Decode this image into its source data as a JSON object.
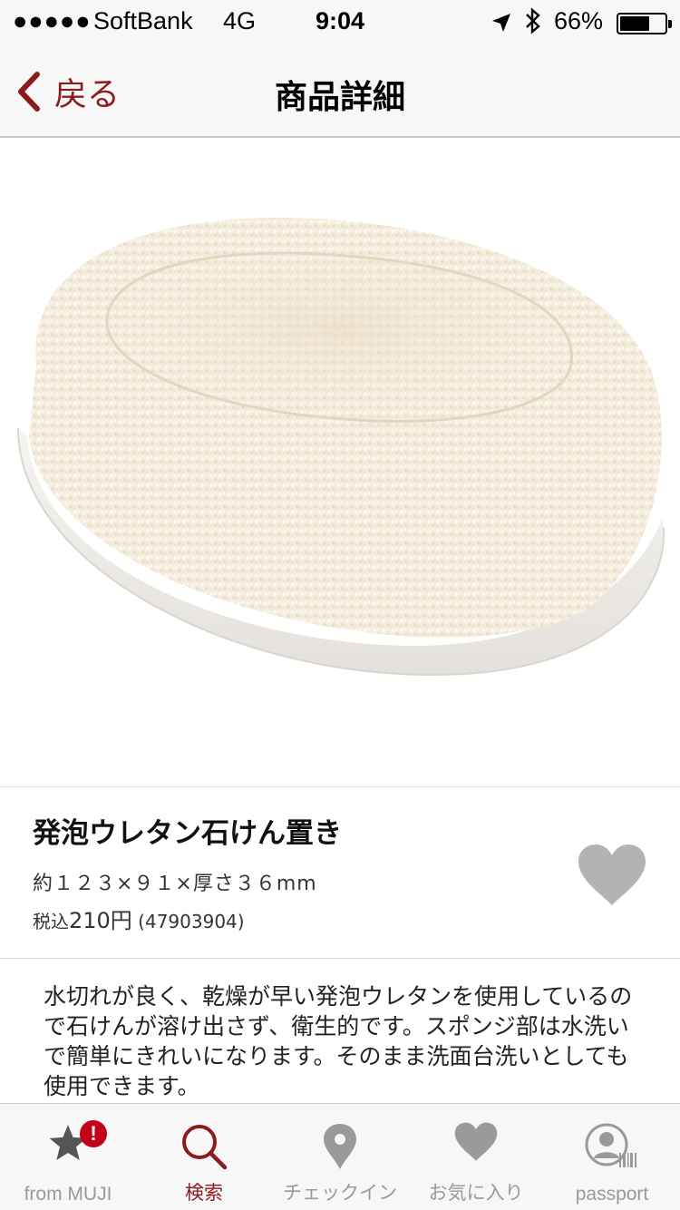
{
  "status_bar": {
    "signal": "●●●●●",
    "carrier": "SoftBank",
    "network": "4G",
    "time": "9:04",
    "battery": "66%",
    "battery_level": 0.66,
    "icons": [
      "location-arrow-icon",
      "bluetooth-icon",
      "battery-icon"
    ]
  },
  "nav": {
    "back_label": "戻る",
    "title": "商品詳細"
  },
  "product": {
    "name": "発泡ウレタン石けん置き",
    "size": "約１２３×９１×厚さ３６mm",
    "price_prefix": "税込",
    "price": "210円",
    "code": "(47903904)",
    "description": "水切れが良く、乾燥が早い発泡ウレタンを使用しているので石けんが溶け出さず、衛生的です。スポンジ部は水洗いで簡単にきれいになります。そのまま洗面台洗いとしても使用できます。"
  },
  "tabs": [
    {
      "label": "from MUJI",
      "icon": "star-icon",
      "badge": "!"
    },
    {
      "label": "検索",
      "icon": "search-icon",
      "active": true
    },
    {
      "label": "チェックイン",
      "icon": "location-pin-icon"
    },
    {
      "label": "お気に入り",
      "icon": "heart-icon"
    },
    {
      "label": "passport",
      "icon": "passport-icon"
    }
  ],
  "colors": {
    "accent": "#8c1c1c",
    "tab_inactive": "#9a9a9a",
    "badge": "#c4001a",
    "favorite": "#b3b3b3"
  }
}
